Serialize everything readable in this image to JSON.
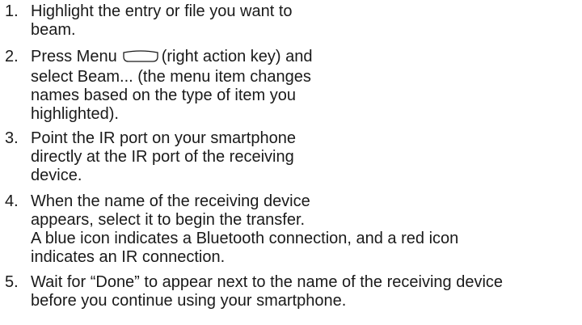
{
  "steps": [
    {
      "number": "1.",
      "lines": [
        "Highlight the entry or file you want to",
        "beam."
      ]
    },
    {
      "number": "2.",
      "line1_before": "Press Menu",
      "line1_after": "(right action key) and",
      "lines": [
        "select Beam... (the menu item changes",
        "names based on the type of item you",
        "highlighted)."
      ],
      "icon": "right-action-key-icon"
    },
    {
      "number": "3.",
      "lines": [
        "Point the IR port on your smartphone",
        "directly at the IR port of the receiving",
        "device."
      ]
    },
    {
      "number": "4.",
      "lines": [
        "When the name of the receiving device",
        "appears, select it to begin the transfer.",
        "A blue icon indicates a Bluetooth connection, and a red icon",
        "indicates an IR connection."
      ]
    },
    {
      "number": "5.",
      "lines": [
        "Wait for “Done” to appear next to the name of the receiving device",
        "before you continue using your smartphone."
      ]
    }
  ]
}
